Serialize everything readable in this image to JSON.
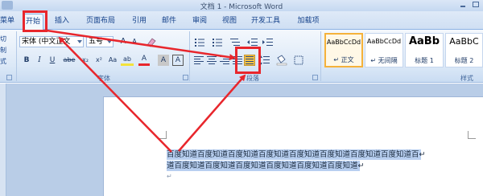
{
  "window": {
    "title": "文档 1 - Microsoft Word"
  },
  "tabs": [
    {
      "label": "菜单"
    },
    {
      "label": "开始"
    },
    {
      "label": "插入"
    },
    {
      "label": "页面布局"
    },
    {
      "label": "引用"
    },
    {
      "label": "邮件"
    },
    {
      "label": "审阅"
    },
    {
      "label": "视图"
    },
    {
      "label": "开发工具"
    },
    {
      "label": "加载项"
    }
  ],
  "ribbon": {
    "left_fragments": [
      "切",
      "制",
      "式"
    ],
    "font": {
      "font_name": "宋体 (中文正文",
      "font_size": "五号",
      "grow": "A",
      "shrink": "A",
      "bold": "B",
      "italic": "I",
      "underline": "U",
      "strike": "abe",
      "subscript": "x₂",
      "superscript": "x²",
      "aa": "Aa",
      "highlight": "ab",
      "font_color": "A",
      "shade": "A",
      "border_char": "A",
      "group_label": "字体"
    },
    "paragraph": {
      "group_label": "段落"
    },
    "styles": {
      "group_label": "样式",
      "items": [
        {
          "sample": "AaBbCcDd",
          "name": "↵ 正文"
        },
        {
          "sample": "AaBbCcDd",
          "name": "↵ 无间隔"
        },
        {
          "sample": "AaBb",
          "name": "标题 1"
        },
        {
          "sample": "AaBbC",
          "name": "标题 2"
        }
      ]
    }
  },
  "document": {
    "line1": "百度知道百度知道百度知道百度知道百度知道百度知道百度知道百度知道百↵",
    "line2": "道百度知道百度知道百度知道百度知道百度知道百度知道↵",
    "empty_para": "↵"
  },
  "colors": {
    "annotation": "#e8262c",
    "selection": "#b8cff0",
    "ribbon_text": "#15428b"
  }
}
